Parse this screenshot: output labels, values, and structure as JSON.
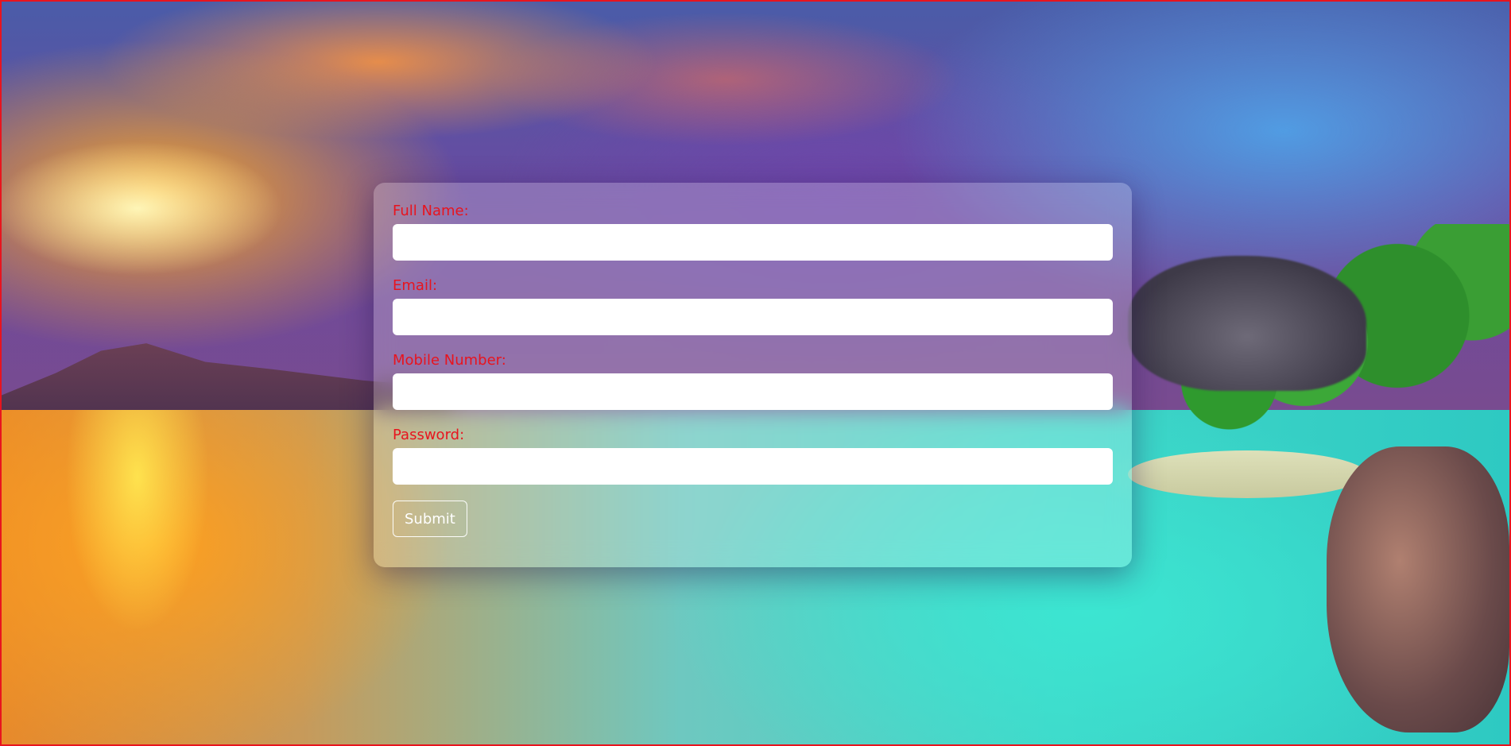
{
  "form": {
    "fields": [
      {
        "label": "Full Name:",
        "value": "",
        "type": "text"
      },
      {
        "label": "Email:",
        "value": "",
        "type": "email"
      },
      {
        "label": "Mobile Number:",
        "value": "",
        "type": "tel"
      },
      {
        "label": "Password:",
        "value": "",
        "type": "password"
      }
    ],
    "submit_label": "Submit"
  },
  "colors": {
    "label": "#e8141e",
    "frame_border": "#e8141e",
    "input_bg": "#ffffff",
    "submit_text": "#ffffff"
  }
}
